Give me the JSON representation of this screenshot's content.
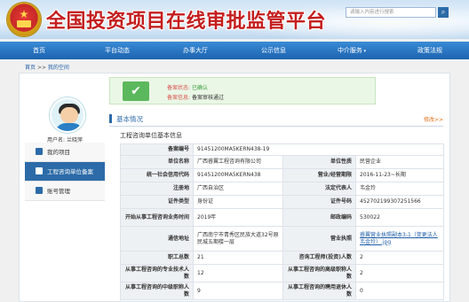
{
  "header": {
    "site_title": "全国投资项目在线审批监管平台",
    "search_placeholder": "请输入内容进行搜索",
    "search_icon": "search-icon",
    "emblem": "national-emblem"
  },
  "nav": {
    "items": [
      {
        "label": "首页"
      },
      {
        "label": "平台动态"
      },
      {
        "label": "办事大厅"
      },
      {
        "label": "公示信息"
      },
      {
        "label": "中介服务"
      },
      {
        "label": "政策法规"
      }
    ]
  },
  "breadcrumb": {
    "home": "首页",
    "sep": ">>",
    "current": "我的空间"
  },
  "status": {
    "record_status_label": "备案状态:",
    "record_status_value": "已确认",
    "record_info_label": "备案信息:",
    "record_info_value": "备案审核通过"
  },
  "profile": {
    "username_label": "用户名:",
    "username": "兰晓萍"
  },
  "sidebar": {
    "items": [
      {
        "label": "我的项目",
        "icon": "grid-icon"
      },
      {
        "label": "工程咨询单位备案",
        "icon": "document-icon"
      },
      {
        "label": "账号管理",
        "icon": "user-icon"
      }
    ]
  },
  "section": {
    "title": "基本情况",
    "edit_label": "修改>>",
    "subtitle": "工程咨询单位基本信息"
  },
  "info": {
    "row1": {
      "l1": "备案编号",
      "v1": "91451200MA5KERN438-19"
    },
    "row2": {
      "l1": "单位名称",
      "v1": "广西睿翼工程咨询有限公司",
      "l2": "单位性质",
      "v2": "民营企业"
    },
    "row3": {
      "l1": "统一社会信用代码",
      "v1": "91451200MA5KERN438",
      "l2": "营业/经营期限",
      "v2": "2016-11-23~长期"
    },
    "row4": {
      "l1": "注册地",
      "v1": "广西自治区",
      "l2": "法定代表人",
      "v2": "韦金玲"
    },
    "row5": {
      "l1": "证件类型",
      "v1": "身份证",
      "l2": "证件号码",
      "v2": "452702199307251566"
    },
    "row6": {
      "l1": "开始从事工程咨询业务时间",
      "v1": "2019年",
      "l2": "邮政编码",
      "v2": "530022"
    },
    "row7": {
      "l1": "通信地址",
      "v1": "广西南宁市青秀区民族大道32号原民城五期楼一层",
      "l2": "营业执照",
      "v2": "睿翼营业执照副本3-1（变更法人韦金玲）.jpg"
    },
    "row8": {
      "l1": "职工总数",
      "v1": "21",
      "l2": "咨询工程师(投资)人数",
      "v2": "2"
    },
    "row9": {
      "l1": "从事工程咨询的专业技术人数",
      "v1": "12",
      "l2": "从事工程咨询的高级职称人数",
      "v2": "2"
    },
    "row10": {
      "l1": "从事工程咨询的中级职称人数",
      "v1": "9",
      "l2": "从事工程咨询的聘用退休人数",
      "v2": "0"
    }
  }
}
